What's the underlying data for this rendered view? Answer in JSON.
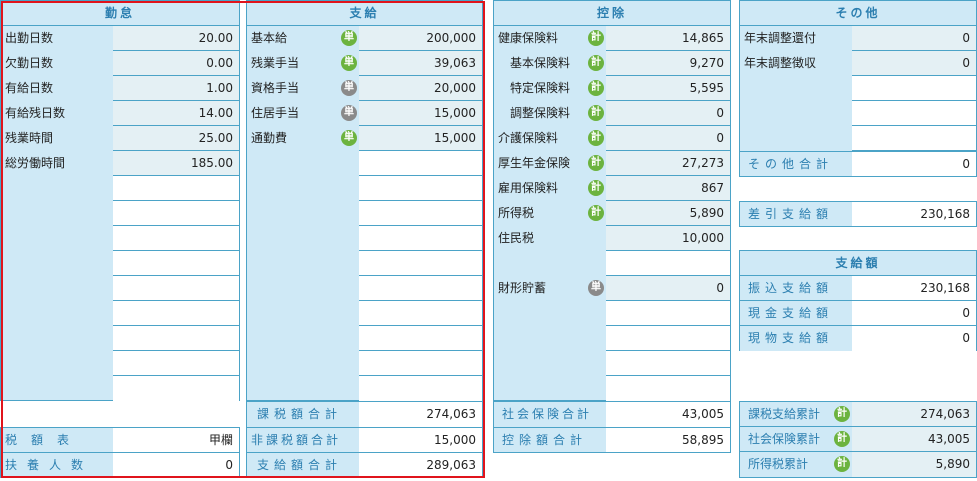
{
  "kinmu": {
    "title": "勤怠",
    "rows": [
      {
        "label": "出勤日数",
        "value": "20.00"
      },
      {
        "label": "欠勤日数",
        "value": "0.00"
      },
      {
        "label": "有給日数",
        "value": "1.00"
      },
      {
        "label": "有給残日数",
        "value": "14.00"
      },
      {
        "label": "残業時間",
        "value": "25.00"
      },
      {
        "label": "総労働時間",
        "value": "185.00"
      }
    ],
    "tax_table_label": "税額表",
    "tax_table_value": "甲欄",
    "dependents_label": "扶養人数",
    "dependents_value": "0"
  },
  "shikyu": {
    "title": "支給",
    "rows": [
      {
        "label": "基本給",
        "badge": "単",
        "badge_color": "green",
        "value": "200,000"
      },
      {
        "label": "残業手当",
        "badge": "単",
        "badge_color": "green",
        "value": "39,063"
      },
      {
        "label": "資格手当",
        "badge": "単",
        "badge_color": "gray",
        "value": "20,000"
      },
      {
        "label": "住居手当",
        "badge": "単",
        "badge_color": "gray",
        "value": "15,000"
      },
      {
        "label": "通勤費",
        "badge": "単",
        "badge_color": "green",
        "value": "15,000"
      }
    ],
    "taxable_total_label": "課税額合計",
    "taxable_total_value": "274,063",
    "nontaxable_total_label": "非課税額合計",
    "nontaxable_total_value": "15,000",
    "payment_total_label": "支給額合計",
    "payment_total_value": "289,063"
  },
  "kojo": {
    "title": "控除",
    "rows": [
      {
        "label": "健康保険料",
        "badge": "計",
        "value": "14,865"
      },
      {
        "label": "基本保険料",
        "badge": "計",
        "value": "9,270"
      },
      {
        "label": "特定保険料",
        "badge": "計",
        "value": "5,595"
      },
      {
        "label": "調整保険料",
        "badge": "計",
        "value": "0"
      },
      {
        "label": "介護保険料",
        "badge": "計",
        "value": "0"
      },
      {
        "label": "厚生年金保険",
        "badge": "計",
        "value": "27,273"
      },
      {
        "label": "雇用保険料",
        "badge": "計",
        "value": "867"
      },
      {
        "label": "所得税",
        "badge": "計",
        "value": "5,890"
      },
      {
        "label": "住民税",
        "value": "10,000"
      }
    ],
    "zaikei_label": "財形貯蓄",
    "zaikei_badge": "単",
    "zaikei_value": "0",
    "social_total_label": "社会保険合計",
    "social_total_value": "43,005",
    "deduction_total_label": "控除額合計",
    "deduction_total_value": "58,895"
  },
  "sonota": {
    "title": "その他",
    "rows": [
      {
        "label": "年末調整還付",
        "value": "0"
      },
      {
        "label": "年末調整徴収",
        "value": "0"
      }
    ],
    "total_label": "その他合計",
    "total_value": "0"
  },
  "net_label": "差引支給額",
  "net_value": "230,168",
  "payment": {
    "title": "支給額",
    "rows": [
      {
        "label": "振込支給額",
        "value": "230,168"
      },
      {
        "label": "現金支給額",
        "value": "0"
      },
      {
        "label": "現物支給額",
        "value": "0"
      }
    ]
  },
  "cumulative": [
    {
      "label": "課税支給累計",
      "badge": "計",
      "value": "274,063"
    },
    {
      "label": "社会保険累計",
      "badge": "計",
      "value": "43,005"
    },
    {
      "label": "所得税累計",
      "badge": "計",
      "value": "5,890"
    }
  ],
  "colors": {
    "accent": "#2c7fb0",
    "header_bg": "#cfe9f6",
    "badge_green": "#6cb33f",
    "badge_gray": "#8a8a8a",
    "highlight": "#e0141c"
  }
}
